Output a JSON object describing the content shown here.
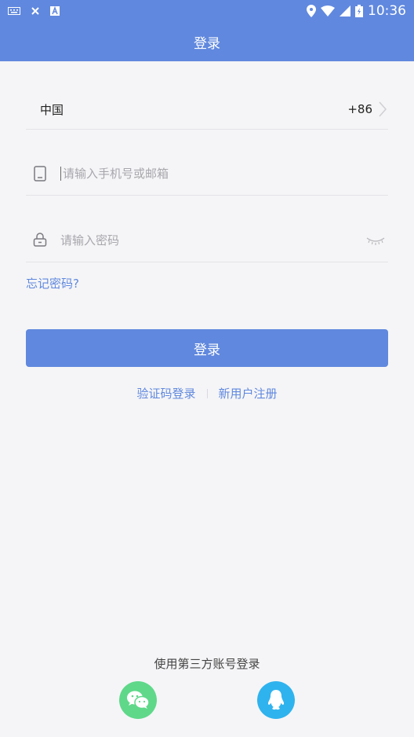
{
  "status_bar": {
    "time": "10:36",
    "left_icons": [
      "keyboard-icon",
      "close-icon",
      "a-icon"
    ],
    "right_icons": [
      "location-icon",
      "wifi-icon",
      "signal-icon",
      "battery-icon"
    ]
  },
  "header": {
    "title": "登录"
  },
  "form": {
    "country_name": "中国",
    "country_code": "+86",
    "phone_placeholder": "请输入手机号或邮箱",
    "password_placeholder": "请输入密码",
    "forgot_label": "忘记密码?",
    "login_label": "登录"
  },
  "links": {
    "sms_login": "验证码登录",
    "register": "新用户注册"
  },
  "third_party": {
    "title": "使用第三方账号登录",
    "providers": [
      "wechat",
      "qq"
    ]
  },
  "colors": {
    "primary": "#6088de",
    "wechat": "#5fd88a",
    "qq": "#2fb3ee",
    "background": "#f5f5f7"
  }
}
